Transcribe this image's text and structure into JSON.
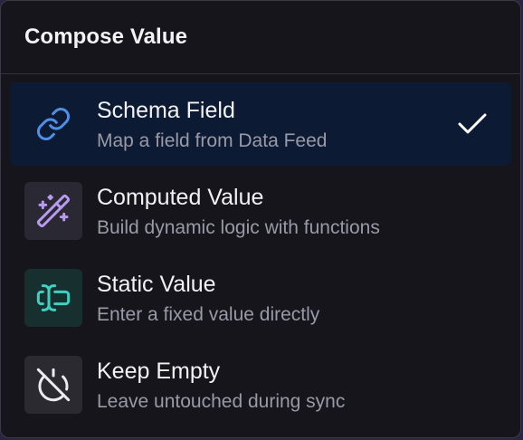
{
  "menu": {
    "title": "Compose Value",
    "options": [
      {
        "title": "Schema Field",
        "description": "Map a field from Data Feed",
        "icon": "link-icon",
        "selected": true,
        "icon_color": "#4f8fe8",
        "icon_bg": "#0d1a33"
      },
      {
        "title": "Computed Value",
        "description": "Build dynamic logic with functions",
        "icon": "magic-wand-icon",
        "selected": false,
        "icon_color": "#b89af0",
        "icon_bg": "#2a2833"
      },
      {
        "title": "Static Value",
        "description": "Enter a fixed value directly",
        "icon": "text-cursor-input-icon",
        "selected": false,
        "icon_color": "#3fd0c0",
        "icon_bg": "#17302f"
      },
      {
        "title": "Keep Empty",
        "description": "Leave untouched during sync",
        "icon": "power-off-icon",
        "selected": false,
        "icon_color": "#ececf0",
        "icon_bg": "#2a2a30"
      }
    ]
  },
  "colors": {
    "panel_bg": "#15151b",
    "selected_bg": "#0d1a33",
    "check": "#ffffff"
  }
}
